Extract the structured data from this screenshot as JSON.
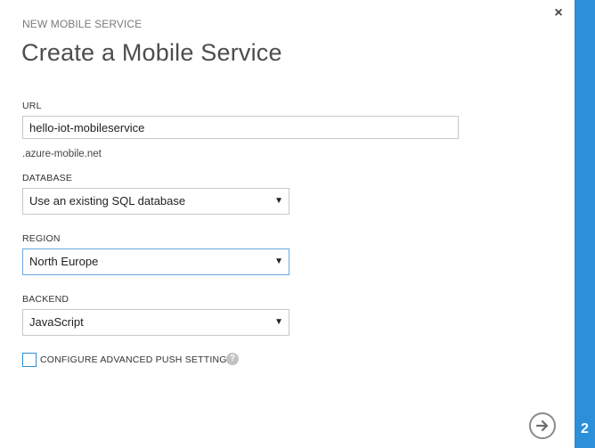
{
  "header": {
    "eyebrow": "NEW MOBILE SERVICE",
    "title": "Create a Mobile Service",
    "close_glyph": "×"
  },
  "form": {
    "url": {
      "label": "URL",
      "value": "hello-iot-mobileservice",
      "suffix": ".azure-mobile.net"
    },
    "database": {
      "label": "DATABASE",
      "selected": "Use an existing SQL database"
    },
    "region": {
      "label": "REGION",
      "selected": "North Europe"
    },
    "backend": {
      "label": "BACKEND",
      "selected": "JavaScript"
    },
    "push": {
      "label": "CONFIGURE ADVANCED PUSH SETTINGS",
      "checked": false,
      "help_glyph": "?"
    }
  },
  "wizard": {
    "step": "2",
    "next_icon": "arrow-right-icon"
  },
  "colors": {
    "accent": "#2b8fd9",
    "title_text": "#4d4d4d",
    "muted_text": "#7a7a7a"
  },
  "icons": {
    "close": "close-icon",
    "dropdown": "chevron-down-icon",
    "help": "help-icon",
    "next": "arrow-right-icon"
  }
}
